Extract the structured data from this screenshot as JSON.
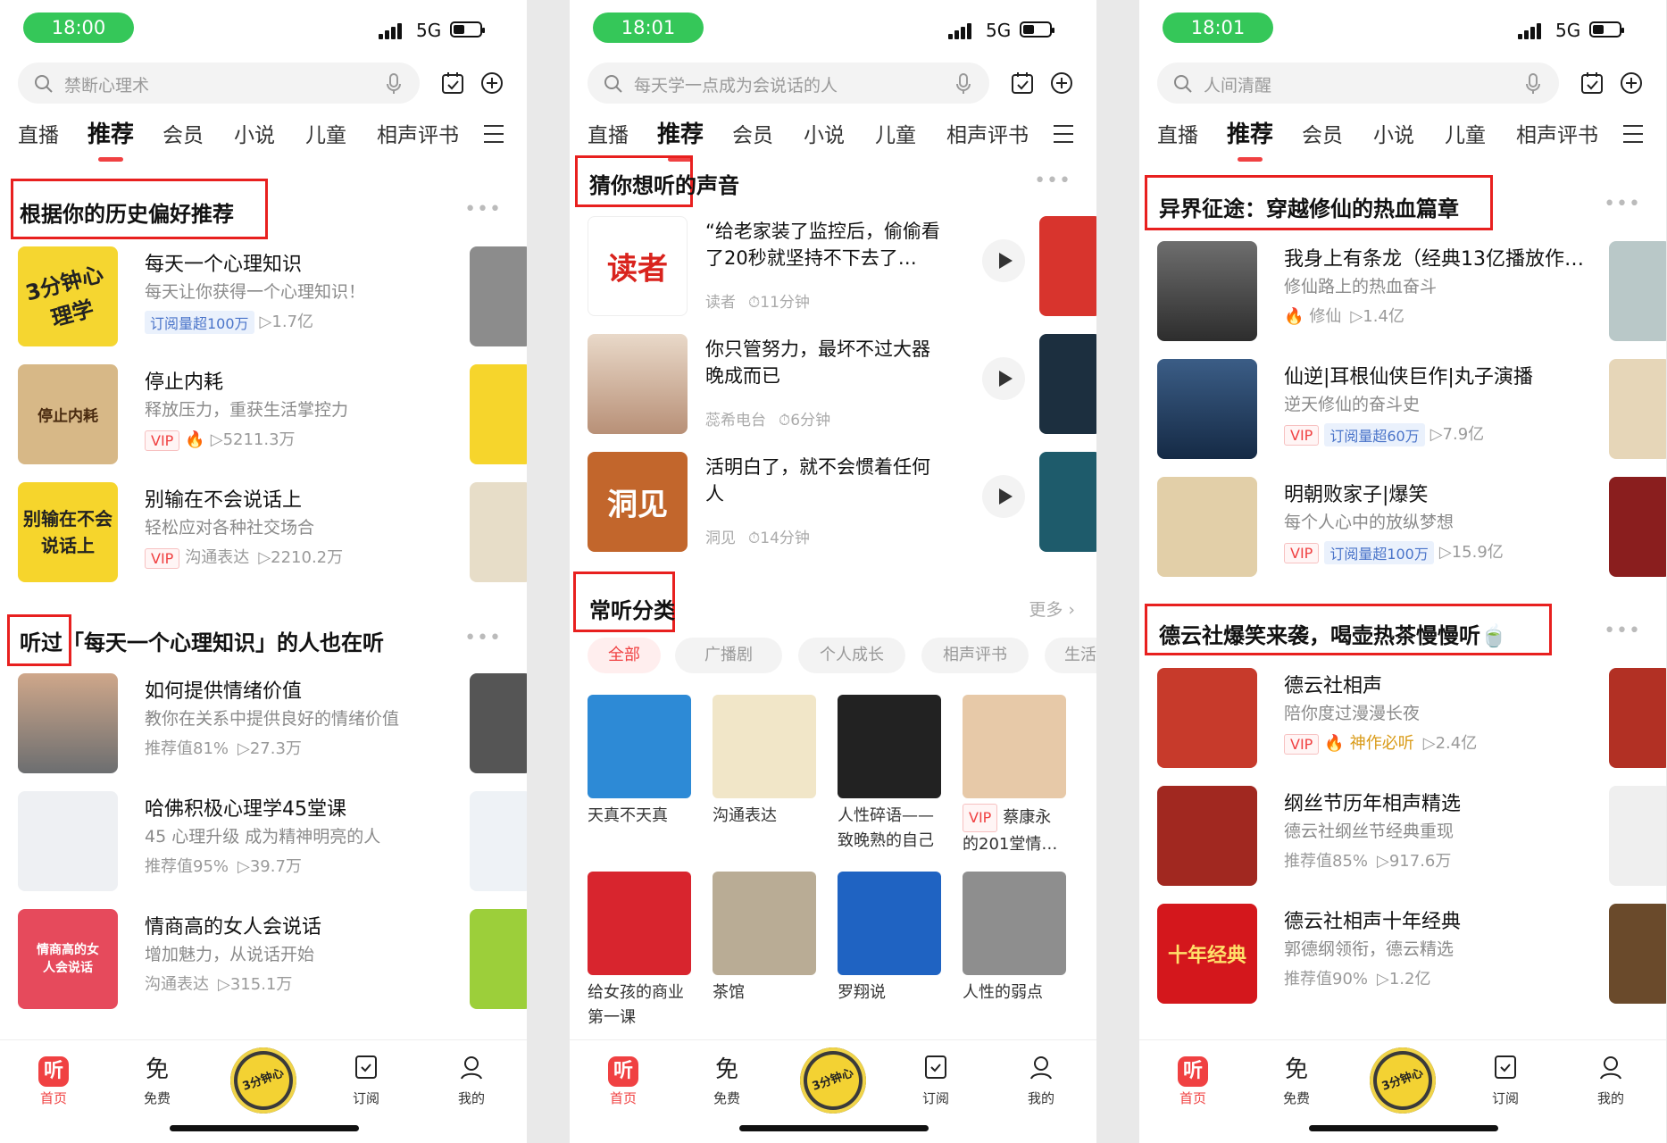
{
  "phones": [
    {
      "time": "18:00",
      "network": "5G",
      "search_placeholder": "禁断心理术",
      "tabs": [
        "直播",
        "推荐",
        "会员",
        "小说",
        "儿童",
        "相声评书"
      ],
      "active_tab": "推荐",
      "sections": [
        {
          "title": "根据你的历史偏好推荐",
          "items": [
            {
              "cover_text": "3分钟心理学",
              "title": "每天一个心理知识",
              "subtitle": "每天让你获得一个心理知识！",
              "badge": "订阅量超100万",
              "plays": "▷1.7亿"
            },
            {
              "cover_text": "停止内耗",
              "title": "停止内耗",
              "subtitle": "释放压力，重获生活掌控力",
              "badge": "VIP",
              "plays": "▷5211.3万"
            },
            {
              "cover_text": "别输在不会说话上",
              "title": "别输在不会说话上",
              "subtitle": "轻松应对各种社交场合",
              "badge": "VIP",
              "tag": "沟通表达",
              "plays": "▷2210.2万"
            }
          ]
        },
        {
          "title_prefix": "听过",
          "title_rest": "「每天一个心理知识」的人也在听",
          "items": [
            {
              "title": "如何提供情绪价值",
              "subtitle": "教你在关系中提供良好的情绪价值",
              "tag": "推荐值81%",
              "plays": "▷27.3万"
            },
            {
              "title": "哈佛积极心理学45堂课",
              "subtitle": "45 心理升级 成为精神明亮的人",
              "tag": "推荐值95%",
              "plays": "▷39.7万"
            },
            {
              "cover_text": "情商高的女人会说话",
              "title": "情商高的女人会说话",
              "subtitle": "增加魅力，从说话开始",
              "tag": "沟通表达",
              "plays": "▷315.1万"
            }
          ]
        }
      ]
    },
    {
      "time": "18:01",
      "network": "5G",
      "search_placeholder": "每天学一点成为会说话的人",
      "tabs": [
        "直播",
        "推荐",
        "会员",
        "小说",
        "儿童",
        "相声评书"
      ],
      "active_tab": "推荐",
      "section1": {
        "title": "猜你想听的声音",
        "items": [
          {
            "cover_text": "读者",
            "title": "“给老家装了监控后，偷偷看了20秒就坚持不下去了…",
            "author": "读者",
            "duration": "⏱11分钟"
          },
          {
            "title": "你只管努力，最坏不过大器晚成而已",
            "author": "蕊希电台",
            "duration": "⏱6分钟"
          },
          {
            "cover_text": "洞见",
            "title": "活明白了，就不会惯着任何人",
            "author": "洞见",
            "duration": "⏱14分钟"
          }
        ]
      },
      "section2": {
        "title": "常听分类",
        "more": "更多 ›",
        "chips": [
          "全部",
          "广播剧",
          "个人成长",
          "相声评书",
          "生活"
        ],
        "grid": [
          {
            "label": "天真不天真"
          },
          {
            "label": "沟通表达"
          },
          {
            "label": "人性碎语——致晚熟的自己"
          },
          {
            "badge": "VIP",
            "label": "蔡康永的201堂情…"
          },
          {
            "label": "给女孩的商业第一课"
          },
          {
            "label": "茶馆"
          },
          {
            "label": "罗翔说"
          },
          {
            "label": "人性的弱点"
          }
        ]
      }
    },
    {
      "time": "18:01",
      "network": "5G",
      "search_placeholder": "人间清醒",
      "tabs": [
        "直播",
        "推荐",
        "会员",
        "小说",
        "儿童",
        "相声评书"
      ],
      "active_tab": "推荐",
      "sections": [
        {
          "title": "异界征途：穿越修仙的热血篇章",
          "items": [
            {
              "title": "我身上有条龙（经典13亿播放作…",
              "subtitle": "修仙路上的热血奋斗",
              "tag": "修仙",
              "plays": "▷1.4亿"
            },
            {
              "title": "仙逆|耳根仙侠巨作|丸子演播",
              "subtitle": "逆天修仙的奋斗史",
              "badge": "VIP",
              "badge2": "订阅量超60万",
              "plays": "▷7.9亿"
            },
            {
              "title": "明朝败家子|爆笑",
              "subtitle": "每个人心中的放纵梦想",
              "badge": "VIP",
              "badge2": "订阅量超100万",
              "plays": "▷15.9亿"
            }
          ]
        },
        {
          "title": "德云社爆笑来袭，喝壶热茶慢慢听🍵",
          "items": [
            {
              "title": "德云社相声",
              "subtitle": "陪你度过漫漫长夜",
              "badge": "VIP",
              "tag": "神作必听",
              "plays": "▷2.4亿"
            },
            {
              "title": "纲丝节历年相声精选",
              "subtitle": "德云社纲丝节经典重现",
              "tag": "推荐值85%",
              "plays": "▷917.6万"
            },
            {
              "cover_text": "十年经典",
              "title": "德云社相声十年经典",
              "subtitle": "郭德纲领衔，德云精选",
              "tag": "推荐值90%",
              "plays": "▷1.2亿"
            }
          ]
        }
      ]
    }
  ],
  "bottom_nav": [
    "首页",
    "免费",
    "订阅",
    "我的"
  ],
  "bottom_icons": {
    "home": "听",
    "free": "免"
  },
  "disc_text": "3分钟心理学",
  "colors": {
    "accent": "#f04142",
    "status_pill": "#35c759",
    "annotation_box": "#e8201f"
  }
}
